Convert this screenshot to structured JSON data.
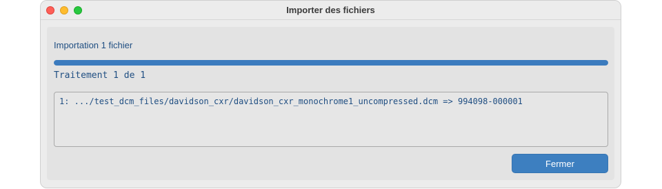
{
  "window": {
    "title": "Importer des fichiers"
  },
  "import": {
    "status": "Importation 1 fichier",
    "progress_percent": 100,
    "processing": "Traitement 1 de 1",
    "log": [
      "1: .../test_dcm_files/davidson_cxr/davidson_cxr_monochrome1_uncompressed.dcm => 994098-000001"
    ]
  },
  "actions": {
    "close_label": "Fermer"
  },
  "colors": {
    "accent": "#3d7fc0",
    "text": "#1f4e82",
    "traffic_close": "#fe5f57",
    "traffic_min": "#febc2e",
    "traffic_max": "#28c840"
  }
}
